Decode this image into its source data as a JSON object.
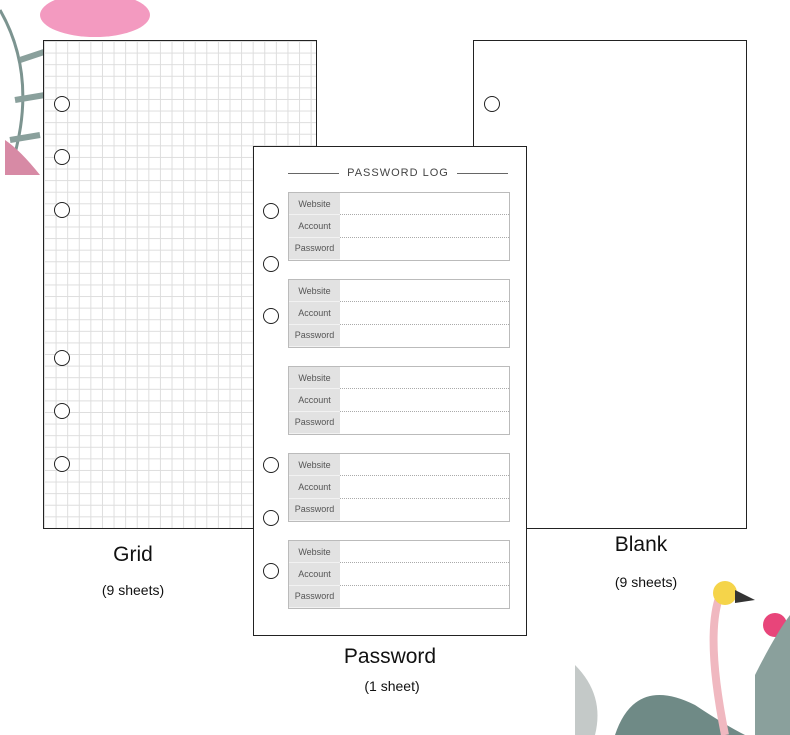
{
  "sheets": {
    "grid": {
      "label": "Grid",
      "count": "(9 sheets)"
    },
    "password": {
      "label": "Password",
      "count": "(1 sheet)",
      "title": "PASSWORD LOG",
      "fields": [
        "Website",
        "Account",
        "Password"
      ],
      "blocks": 5
    },
    "blank": {
      "label": "Blank",
      "count": "(9 sheets)"
    }
  },
  "colors": {
    "flamingo": "#f08cb0",
    "leaf": "#6f8a86"
  }
}
